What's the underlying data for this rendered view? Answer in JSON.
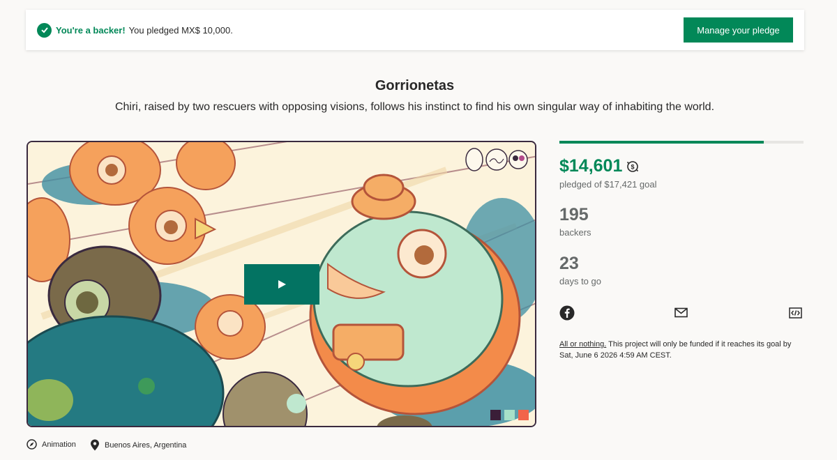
{
  "banner": {
    "backer_strong": "You're a backer!",
    "backer_text": "You pledged MX$ 10,000.",
    "manage_label": "Manage your pledge"
  },
  "project": {
    "title": "Gorrionetas",
    "blurb": "Chiri, raised by two rescuers with opposing visions, follows his instinct to find his own singular way of inhabiting the world."
  },
  "stats": {
    "pledged": "$14,601",
    "pledged_of_goal": "pledged of $17,421 goal",
    "funded_fraction": 0.838,
    "backers_count": "195",
    "backers_label": "backers",
    "days_count": "23",
    "days_label": "days to go"
  },
  "share": {
    "icons": [
      "facebook-icon",
      "mail-icon",
      "embed-icon"
    ]
  },
  "funding_note": {
    "link_text": "All or nothing.",
    "text": " This project will only be funded if it reaches its goal by Sat, June 6 2026 4:59 AM CEST."
  },
  "meta": {
    "category": "Animation",
    "location": "Buenos Aires, Argentina"
  },
  "colors": {
    "brand_green": "#028858",
    "play_button": "#037362",
    "page_background": "#faf9f7"
  }
}
